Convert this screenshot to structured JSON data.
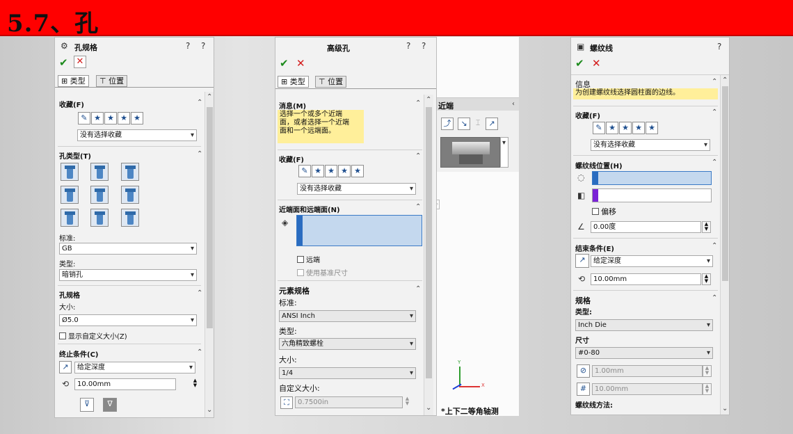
{
  "slide": {
    "title": "5.7、孔"
  },
  "panel1": {
    "title": "孔规格",
    "tabs": [
      "类型",
      "位置"
    ],
    "favorites": {
      "title": "收藏(F)",
      "select": "没有选择收藏"
    },
    "hole_type": {
      "title": "孔类型(T)"
    },
    "standard_label": "标准:",
    "standard": "GB",
    "type_label": "类型:",
    "type": "暗销孔",
    "spec": {
      "title": "孔规格",
      "size_label": "大小:",
      "size": "Ø5.0",
      "custom": "显示自定义大小(Z)"
    },
    "end": {
      "title": "终止条件(C)",
      "condition": "给定深度",
      "depth": "10.00mm"
    }
  },
  "panel2": {
    "title": "高级孔",
    "tabs": [
      "类型",
      "位置"
    ],
    "message": {
      "title": "消息(M)",
      "lines": [
        "选择一个或多个近端",
        "面，或者选择一个近端",
        "面和一个远端面。"
      ]
    },
    "favorites": {
      "title": "收藏(F)",
      "select": "没有选择收藏"
    },
    "faces": {
      "title": "近端面和远端面(N)",
      "far": "远端",
      "use_base": "使用基准尺寸"
    },
    "element": {
      "title": "元素规格",
      "standard_label": "标准:",
      "standard": "ANSI Inch",
      "type_label": "类型:",
      "type": "六角精致螺栓",
      "size_label": "大小:",
      "size": "1/4",
      "custom_label": "自定义大小:",
      "custom_value": "0.7500in"
    }
  },
  "flyout": {
    "title": "近端",
    "view_label": "*上下二等角轴测"
  },
  "panel3": {
    "title": "螺纹线",
    "info": {
      "title": "信息",
      "message": "为创建螺纹线选择圆柱面的边线。"
    },
    "favorites": {
      "title": "收藏(F)",
      "select": "没有选择收藏"
    },
    "position": {
      "title": "螺纹线位置(H)",
      "offset": "偏移",
      "angle": "0.00度"
    },
    "end": {
      "title": "结束条件(E)",
      "condition": "给定深度",
      "depth": "10.00mm"
    },
    "spec": {
      "title": "规格",
      "type_label": "类型:",
      "type": "Inch Die",
      "size_label": "尺寸",
      "size": "#0-80",
      "diameter": "1.00mm",
      "pitch": "10.00mm",
      "method_label": "螺纹线方法:"
    }
  },
  "colors": {
    "title_bar": "#ff0000",
    "accent_blue": "#2a6cc0",
    "message_bg": "#ffef9a"
  }
}
